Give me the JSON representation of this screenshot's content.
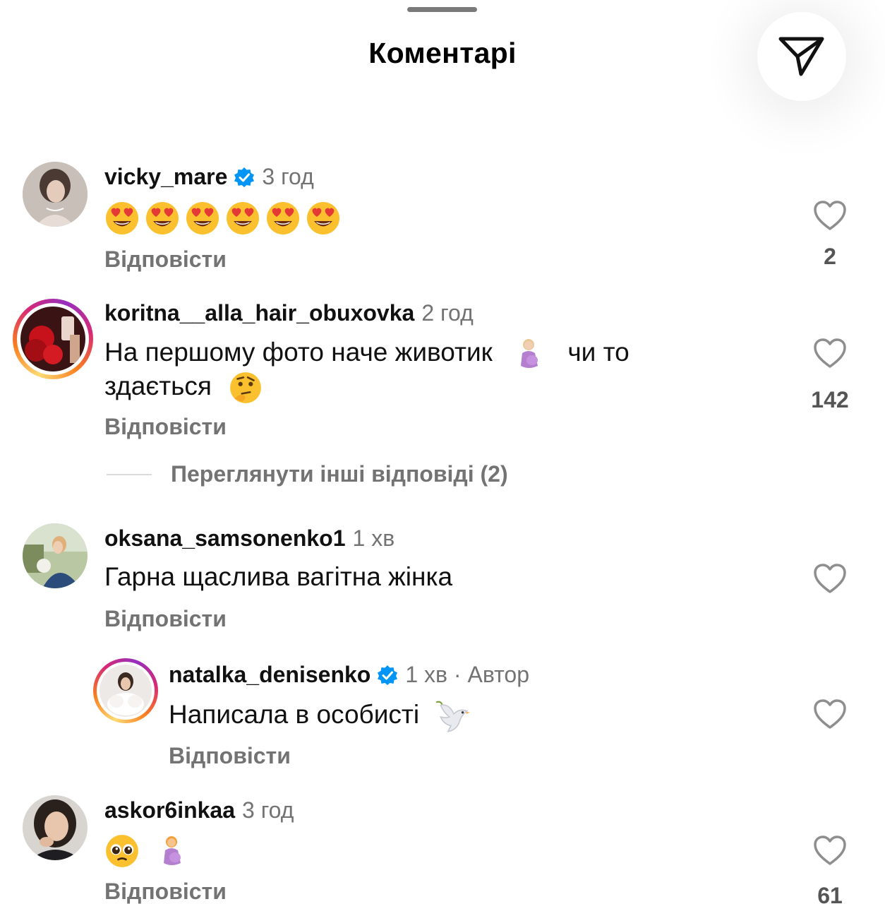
{
  "header": {
    "title": "Коментарі",
    "share_icon": "paper-plane-icon"
  },
  "comments": [
    {
      "username": "vicky_mare",
      "verified": true,
      "time": "3 год",
      "text": "",
      "emojis": [
        "smiling-face-with-heart-eyes",
        "smiling-face-with-heart-eyes",
        "smiling-face-with-heart-eyes",
        "smiling-face-with-heart-eyes",
        "smiling-face-with-heart-eyes",
        "smiling-face-with-heart-eyes"
      ],
      "reply_label": "Відповісти",
      "likes": "2"
    },
    {
      "username": "koritna__alla_hair_obuxovka",
      "verified": false,
      "time": "2 год",
      "text_line1": "На першому фото наче животик",
      "text_line1_end": "чи то",
      "text_line2": "здається",
      "emojis": [
        "pregnant-woman",
        "thinking-face"
      ],
      "reply_label": "Відповісти",
      "likes": "142",
      "more_replies": "Переглянути інші відповіді (2)"
    },
    {
      "username": "oksana_samsonenko1",
      "verified": false,
      "time": "1 хв",
      "text": "Гарна щаслива вагітна жінка",
      "reply_label": "Відповісти",
      "likes": ""
    },
    {
      "username": "natalka_denisenko",
      "verified": true,
      "time": "1 хв · Автор",
      "text": "Написала в особисті",
      "emojis": [
        "dove"
      ],
      "reply_label": "Відповісти",
      "likes": ""
    },
    {
      "username": "askor6inkaa",
      "verified": false,
      "time": "3 год",
      "text": "",
      "emojis": [
        "pleading-face",
        "pregnant-woman"
      ],
      "reply_label": "Відповісти",
      "likes": "61"
    }
  ],
  "colors": {
    "verified_blue": "#0095f6",
    "muted_text": "#737373",
    "heart_stroke": "#8e8e8e"
  }
}
